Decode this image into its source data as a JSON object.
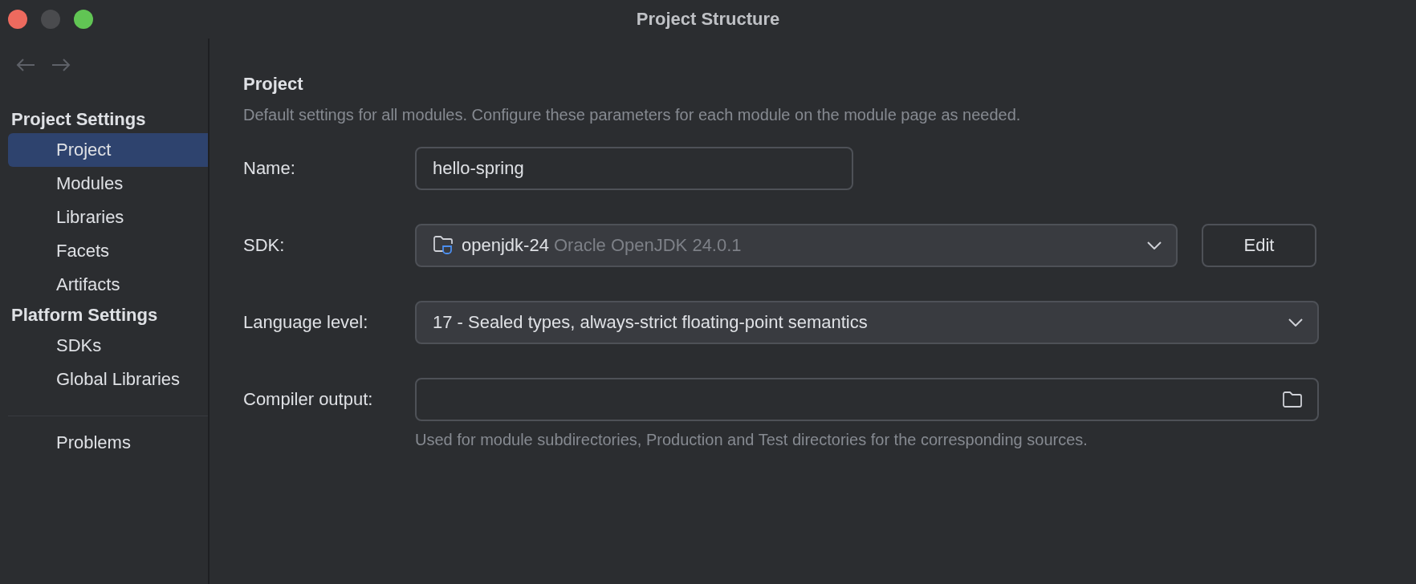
{
  "window": {
    "title": "Project Structure"
  },
  "sidebar": {
    "groups": [
      {
        "title": "Project Settings",
        "items": [
          {
            "label": "Project",
            "selected": true
          },
          {
            "label": "Modules",
            "selected": false
          },
          {
            "label": "Libraries",
            "selected": false
          },
          {
            "label": "Facets",
            "selected": false
          },
          {
            "label": "Artifacts",
            "selected": false
          }
        ]
      },
      {
        "title": "Platform Settings",
        "items": [
          {
            "label": "SDKs",
            "selected": false
          },
          {
            "label": "Global Libraries",
            "selected": false
          }
        ]
      }
    ],
    "footer_items": [
      {
        "label": "Problems",
        "selected": false
      }
    ]
  },
  "content": {
    "heading": "Project",
    "description": "Default settings for all modules. Configure these parameters for each module on the module page as needed.",
    "fields": [
      {
        "kind": "text",
        "label": "Name:",
        "value": "hello-spring"
      },
      {
        "kind": "sdk",
        "label": "SDK:",
        "value": "openjdk-24",
        "detail": "Oracle OpenJDK 24.0.1",
        "button": "Edit"
      },
      {
        "kind": "select",
        "label": "Language level:",
        "value": "17 - Sealed types, always-strict floating-point semantics"
      },
      {
        "kind": "path",
        "label": "Compiler output:",
        "hint": "Used for module subdirectories, Production and Test directories for the corresponding sources."
      }
    ]
  }
}
